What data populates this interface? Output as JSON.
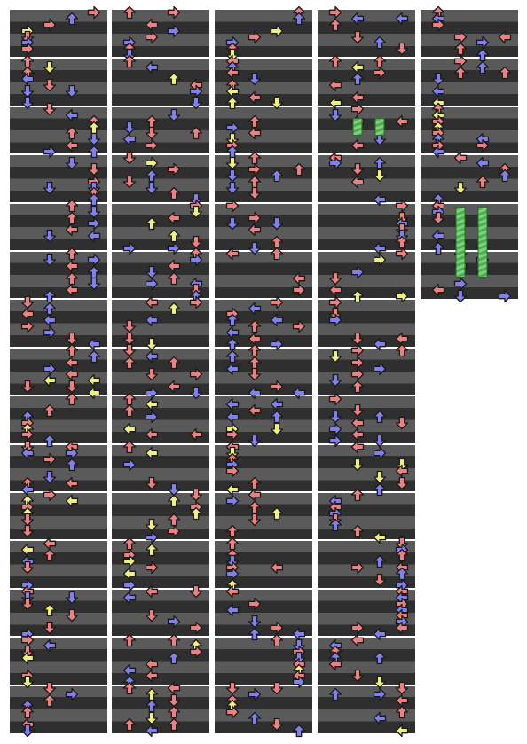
{
  "chart": {
    "columns": 5,
    "measure_counts": [
      15,
      15,
      15,
      15,
      6
    ],
    "last_column_rows": 6
  },
  "colors": {
    "row_light": "#5a5a5a",
    "row_dark": "#2f2f2f",
    "measure_line": "#ffffff",
    "quarter_note": "#f08080",
    "eighth_note": "#8080f0",
    "sixteenth_note": "#f0f080",
    "hold_body": "#4caf50",
    "hold_head": "#c8e6a0",
    "background": "#ffffff"
  },
  "icons": {
    "left": "left-arrow-icon",
    "down": "down-arrow-icon",
    "up": "up-arrow-icon",
    "right": "right-arrow-icon",
    "hold": "hold-note-icon"
  }
}
